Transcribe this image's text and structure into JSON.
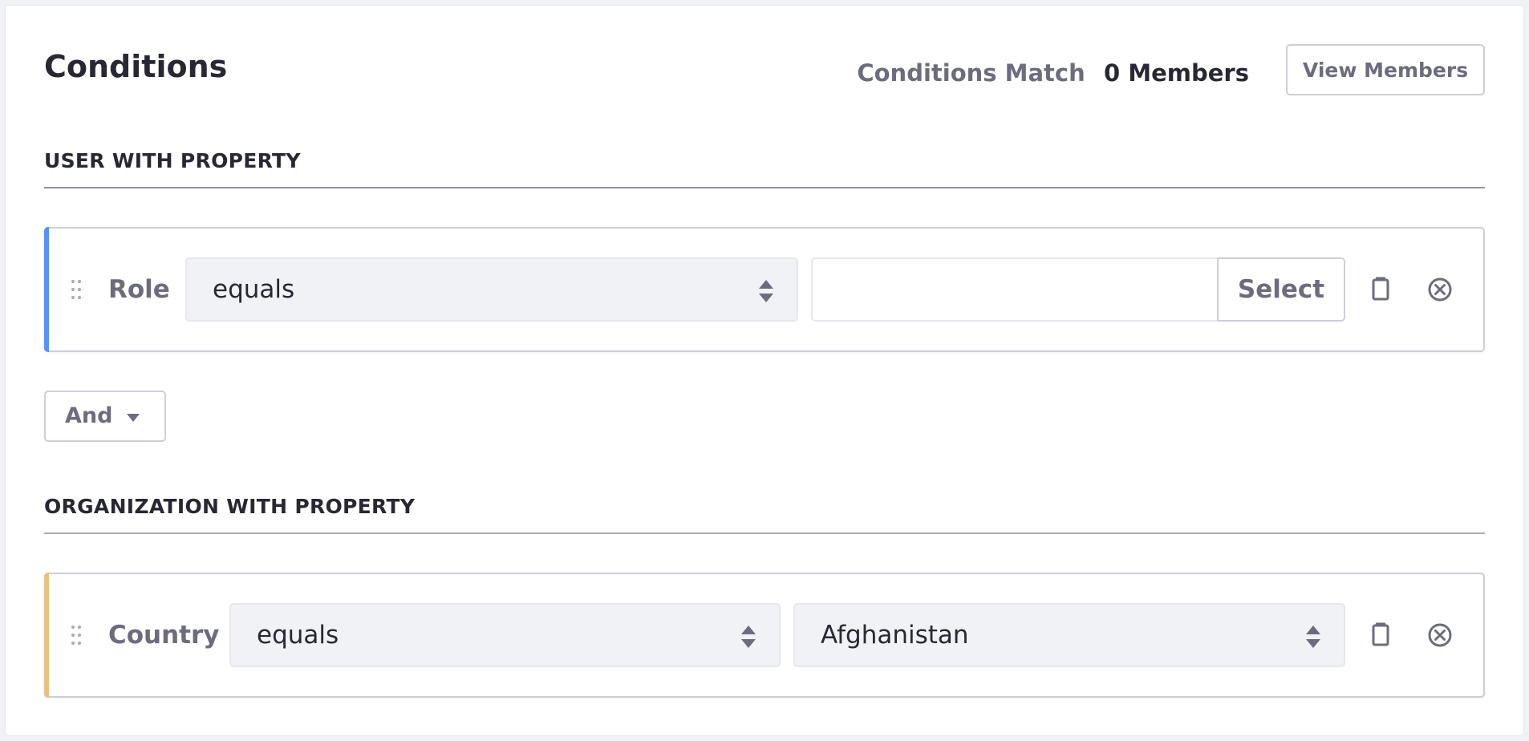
{
  "header": {
    "title": "Conditions",
    "match_label": "Conditions Match",
    "match_count": "0 Members",
    "view_members_label": "View Members"
  },
  "sections": [
    {
      "title": "USER WITH PROPERTY",
      "accent_color": "#5791ff",
      "criterion": {
        "label": "Role",
        "operator": "equals",
        "value": "",
        "select_button_label": "Select"
      }
    },
    {
      "title": "ORGANIZATION WITH PROPERTY",
      "accent_color": "#e9c07e",
      "criterion": {
        "label": "Country",
        "operator": "equals",
        "value": "Afghanistan"
      }
    }
  ],
  "conjunction": {
    "label": "And"
  },
  "icons": {
    "drag": "drag-handle-icon",
    "duplicate": "duplicate-icon",
    "remove": "times-circle-icon",
    "select_arrows": "caret-double-icon",
    "dropdown": "caret-bottom-icon"
  }
}
